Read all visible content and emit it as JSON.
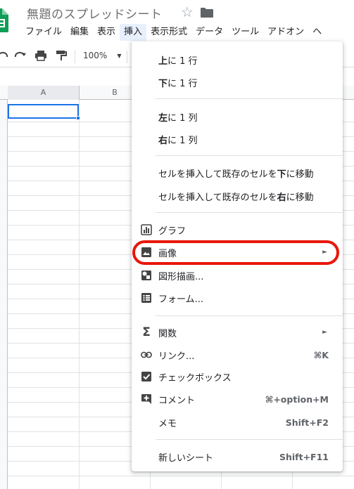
{
  "document": {
    "title": "無題のスプレッドシート"
  },
  "menubar": {
    "items": [
      "ファイル",
      "編集",
      "表示",
      "挿入",
      "表示形式",
      "データ",
      "ツール",
      "アドオン",
      "ヘ"
    ],
    "active_index": 3
  },
  "toolbar": {
    "zoom": "100%"
  },
  "grid": {
    "columns": [
      "A",
      "B"
    ],
    "active_cell": "A1"
  },
  "insert_menu": {
    "row_above": [
      "上",
      "に 1 行"
    ],
    "row_below": [
      "下",
      "に 1 行"
    ],
    "col_left": [
      "左",
      "に 1 列"
    ],
    "col_right": [
      "右",
      "に 1 列"
    ],
    "shift_down": [
      "セルを挿入して既存のセルを",
      "下",
      "に移動"
    ],
    "shift_right": [
      "セルを挿入して既存のセルを",
      "右",
      "に移動"
    ],
    "chart": "グラフ",
    "image": "画像",
    "drawing": "図形描画...",
    "form": "フォーム...",
    "function": "関数",
    "link": {
      "label": "リンク...",
      "shortcut": "⌘K"
    },
    "checkbox": "チェックボックス",
    "comment": {
      "label": "コメント",
      "shortcut": "⌘+option+M"
    },
    "note": {
      "label": "メモ",
      "shortcut": "Shift+F2"
    },
    "new_sheet": {
      "label": "新しいシート",
      "shortcut": "Shift+F11"
    }
  },
  "colors": {
    "accent": "#1a73e8",
    "highlight_ring": "#e8170b",
    "sheets_green": "#0f9d58"
  },
  "icons": [
    "undo-icon",
    "redo-icon",
    "print-icon",
    "paint-format-icon",
    "chart-icon",
    "image-icon",
    "drawing-icon",
    "form-icon",
    "sigma-icon",
    "link-icon",
    "checkbox-icon",
    "comment-icon"
  ]
}
